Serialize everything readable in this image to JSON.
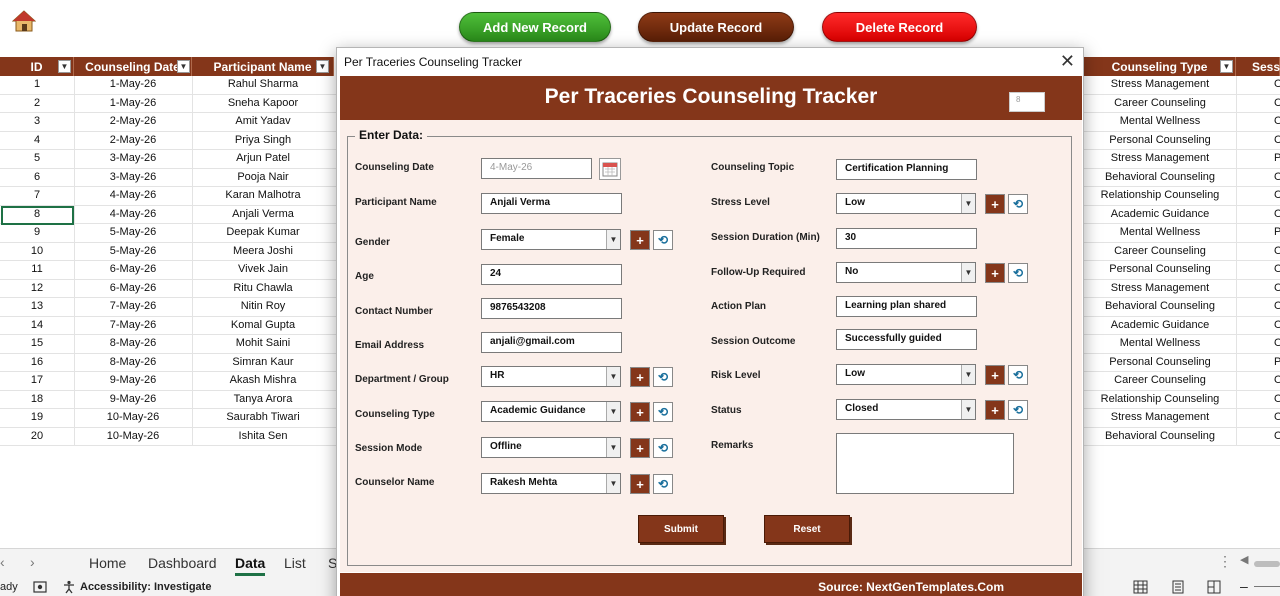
{
  "toolbar": {
    "add_label": "Add New Record",
    "update_label": "Update Record",
    "delete_label": "Delete Record"
  },
  "table": {
    "headers_left": [
      "ID",
      "Counseling Date",
      "Participant Name"
    ],
    "headers_right": [
      "Counseling Type",
      "Sess"
    ],
    "rows": [
      {
        "id": "1",
        "date": "1-May-26",
        "name": "Rahul Sharma",
        "type": "Stress Management",
        "sess": "O"
      },
      {
        "id": "2",
        "date": "1-May-26",
        "name": "Sneha Kapoor",
        "type": "Career Counseling",
        "sess": "C"
      },
      {
        "id": "3",
        "date": "2-May-26",
        "name": "Amit Yadav",
        "type": "Mental Wellness",
        "sess": "O"
      },
      {
        "id": "4",
        "date": "2-May-26",
        "name": "Priya Singh",
        "type": "Personal Counseling",
        "sess": "C"
      },
      {
        "id": "5",
        "date": "3-May-26",
        "name": "Arjun Patel",
        "type": "Stress Management",
        "sess": "Ph"
      },
      {
        "id": "6",
        "date": "3-May-26",
        "name": "Pooja Nair",
        "type": "Behavioral Counseling",
        "sess": "O"
      },
      {
        "id": "7",
        "date": "4-May-26",
        "name": "Karan Malhotra",
        "type": "Relationship Counseling",
        "sess": "C"
      },
      {
        "id": "8",
        "date": "4-May-26",
        "name": "Anjali Verma",
        "type": "Academic Guidance",
        "sess": "O"
      },
      {
        "id": "9",
        "date": "5-May-26",
        "name": "Deepak Kumar",
        "type": "Mental Wellness",
        "sess": "Ph"
      },
      {
        "id": "10",
        "date": "5-May-26",
        "name": "Meera Joshi",
        "type": "Career Counseling",
        "sess": "O"
      },
      {
        "id": "11",
        "date": "6-May-26",
        "name": "Vivek Jain",
        "type": "Personal Counseling",
        "sess": "O"
      },
      {
        "id": "12",
        "date": "6-May-26",
        "name": "Ritu Chawla",
        "type": "Stress Management",
        "sess": "C"
      },
      {
        "id": "13",
        "date": "7-May-26",
        "name": "Nitin Roy",
        "type": "Behavioral Counseling",
        "sess": "O"
      },
      {
        "id": "14",
        "date": "7-May-26",
        "name": "Komal Gupta",
        "type": "Academic Guidance",
        "sess": "O"
      },
      {
        "id": "15",
        "date": "8-May-26",
        "name": "Mohit Saini",
        "type": "Mental Wellness",
        "sess": "O"
      },
      {
        "id": "16",
        "date": "8-May-26",
        "name": "Simran Kaur",
        "type": "Personal Counseling",
        "sess": "Ph"
      },
      {
        "id": "17",
        "date": "9-May-26",
        "name": "Akash Mishra",
        "type": "Career Counseling",
        "sess": "O"
      },
      {
        "id": "18",
        "date": "9-May-26",
        "name": "Tanya Arora",
        "type": "Relationship Counseling",
        "sess": "O"
      },
      {
        "id": "19",
        "date": "10-May-26",
        "name": "Saurabh Tiwari",
        "type": "Stress Management",
        "sess": "O"
      },
      {
        "id": "20",
        "date": "10-May-26",
        "name": "Ishita Sen",
        "type": "Behavioral Counseling",
        "sess": "O"
      }
    ]
  },
  "sheet_tabs": {
    "home": "Home",
    "dashboard": "Dashboard",
    "data": "Data",
    "list": "List",
    "cut": "S"
  },
  "status": {
    "ready": "ady",
    "accessibility": "Accessibility: Investigate"
  },
  "dialog": {
    "window_title": "Per Traceries Counseling Tracker",
    "banner_title": "Per Traceries Counseling Tracker",
    "record_id": "8",
    "legend": "Enter Data:",
    "left": {
      "counseling_date_label": "Counseling Date",
      "counseling_date_value": "4-May-26",
      "participant_name_label": "Participant Name",
      "participant_name_value": "Anjali Verma",
      "gender_label": "Gender",
      "gender_value": "Female",
      "age_label": "Age",
      "age_value": "24",
      "contact_label": "Contact Number",
      "contact_value": "9876543208",
      "email_label": "Email Address",
      "email_value": "anjali@gmail.com",
      "department_label": "Department / Group",
      "department_value": "HR",
      "counseling_type_label": "Counseling Type",
      "counseling_type_value": "Academic Guidance",
      "session_mode_label": "Session Mode",
      "session_mode_value": "Offline",
      "counselor_label": "Counselor Name",
      "counselor_value": "Rakesh Mehta"
    },
    "right": {
      "topic_label": "Counseling Topic",
      "topic_value": "Certification Planning",
      "stress_label": "Stress Level",
      "stress_value": "Low",
      "duration_label": "Session Duration (Min)",
      "duration_value": "30",
      "followup_label": "Follow-Up Required",
      "followup_value": "No",
      "action_label": "Action Plan",
      "action_value": "Learning plan shared",
      "outcome_label": "Session Outcome",
      "outcome_value": "Successfully guided",
      "risk_label": "Risk Level",
      "risk_value": "Low",
      "status_label": "Status",
      "status_value": "Closed",
      "remarks_label": "Remarks",
      "remarks_value": ""
    },
    "submit_label": "Submit",
    "reset_label": "Reset",
    "footer": "Source: NextGenTemplates.Com",
    "add_glyph": "+",
    "refresh_glyph": "⟲"
  },
  "colors": {
    "brand": "#84361a",
    "form_bg": "#fbefea",
    "add_green": "#3aa82a",
    "delete_red": "#e60000"
  }
}
